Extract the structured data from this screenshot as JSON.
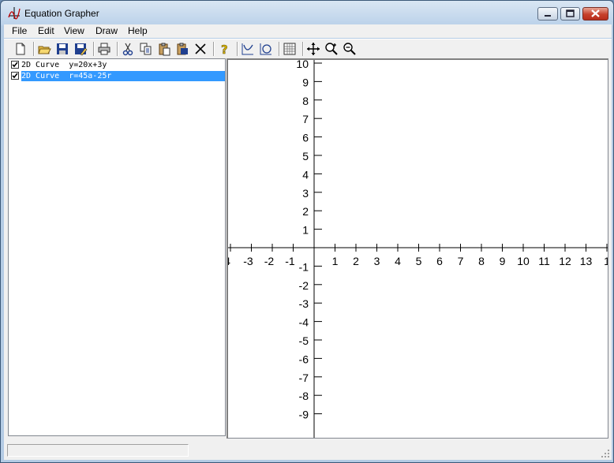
{
  "window": {
    "title": "Equation Grapher"
  },
  "menu": [
    "File",
    "Edit",
    "View",
    "Draw",
    "Help"
  ],
  "toolbar": [
    {
      "name": "new-icon"
    },
    {
      "sep": true
    },
    {
      "name": "open-icon"
    },
    {
      "name": "save-icon"
    },
    {
      "name": "save-as-icon"
    },
    {
      "sep": true
    },
    {
      "name": "print-icon"
    },
    {
      "sep": true
    },
    {
      "name": "cut-icon"
    },
    {
      "name": "copy-icon"
    },
    {
      "name": "paste-icon"
    },
    {
      "name": "paste-special-icon"
    },
    {
      "name": "delete-icon"
    },
    {
      "sep": true
    },
    {
      "name": "help-icon"
    },
    {
      "sep": true
    },
    {
      "name": "add-curve-icon"
    },
    {
      "name": "add-polar-icon"
    },
    {
      "sep": true
    },
    {
      "name": "grid-icon"
    },
    {
      "sep": true
    },
    {
      "name": "pan-icon"
    },
    {
      "name": "zoom-in-icon"
    },
    {
      "name": "zoom-out-icon"
    }
  ],
  "equations": [
    {
      "label": "2D Curve  y=20x+3y",
      "checked": true,
      "selected": false
    },
    {
      "label": "2D Curve  r=45a-25r",
      "checked": true,
      "selected": true
    }
  ],
  "graph": {
    "x_ticks": [
      "4",
      "-3",
      "-2",
      "-1",
      "1",
      "2",
      "3",
      "4",
      "5",
      "6",
      "7",
      "8",
      "9",
      "10",
      "11",
      "12",
      "13",
      "1"
    ],
    "y_ticks_pos": [
      "10",
      "9",
      "8",
      "7",
      "6",
      "5",
      "4",
      "3",
      "2",
      "1"
    ],
    "y_ticks_neg": [
      "-1",
      "-2",
      "-3",
      "-4",
      "-5",
      "-6",
      "-7",
      "-8",
      "-9"
    ]
  },
  "colors": {
    "selection": "#3399ff",
    "axis": "#000000"
  }
}
